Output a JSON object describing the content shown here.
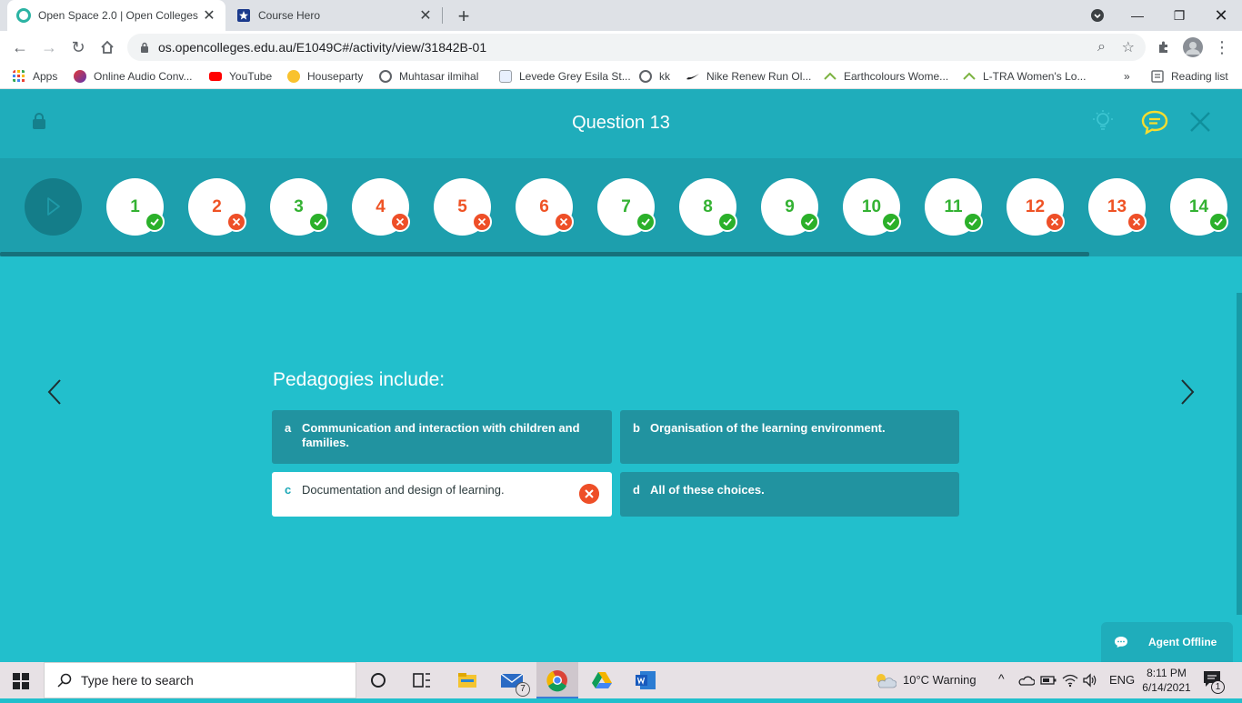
{
  "browser": {
    "tabs": [
      {
        "title": "Open Space 2.0 | Open Colleges",
        "active": true
      },
      {
        "title": "Course Hero",
        "active": false
      }
    ],
    "new_tab_label": "+",
    "url": "os.opencolleges.edu.au/E1049C#/activity/view/31842B-01",
    "bookmarks": [
      {
        "label": "Apps",
        "icon": "apps-grid-icon"
      },
      {
        "label": "Online Audio Conv...",
        "icon": "audio-converter-icon"
      },
      {
        "label": "YouTube",
        "icon": "youtube-icon"
      },
      {
        "label": "Houseparty",
        "icon": "houseparty-icon"
      },
      {
        "label": "Muhtasar ilmihal",
        "icon": "globe-icon"
      },
      {
        "label": "Levede Grey Esila St...",
        "icon": "store-icon"
      },
      {
        "label": "kk",
        "icon": "globe-icon"
      },
      {
        "label": "Nike Renew Run Ol...",
        "icon": "nike-icon"
      },
      {
        "label": "Earthcolours Wome...",
        "icon": "brand-icon"
      },
      {
        "label": "L-TRA Women's Lo...",
        "icon": "brand-icon"
      }
    ],
    "more_bookmarks": "»",
    "reading_list": "Reading list"
  },
  "app": {
    "title": "Question 13",
    "questions": [
      {
        "num": "1",
        "status": "correct"
      },
      {
        "num": "2",
        "status": "wrong"
      },
      {
        "num": "3",
        "status": "correct"
      },
      {
        "num": "4",
        "status": "wrong"
      },
      {
        "num": "5",
        "status": "wrong"
      },
      {
        "num": "6",
        "status": "wrong"
      },
      {
        "num": "7",
        "status": "correct"
      },
      {
        "num": "8",
        "status": "correct"
      },
      {
        "num": "9",
        "status": "correct"
      },
      {
        "num": "10",
        "status": "correct"
      },
      {
        "num": "11",
        "status": "correct"
      },
      {
        "num": "12",
        "status": "wrong"
      },
      {
        "num": "13",
        "status": "wrong"
      },
      {
        "num": "14",
        "status": "correct"
      }
    ],
    "prompt": "Pedagogies include:",
    "options": [
      {
        "letter": "a",
        "text": "Communication and interaction with children and families.",
        "selected": false
      },
      {
        "letter": "b",
        "text": "Organisation of the learning environment.",
        "selected": false
      },
      {
        "letter": "c",
        "text": "Documentation and design of learning.",
        "selected": true
      },
      {
        "letter": "d",
        "text": "All of these choices.",
        "selected": false
      }
    ],
    "agent_label": "Agent Offline"
  },
  "taskbar": {
    "search_placeholder": "Type here to search",
    "mail_count": "7",
    "weather": "10°C  Warning",
    "language": "ENG",
    "time": "8:11 PM",
    "date": "6/14/2021",
    "notifications": "1"
  },
  "colors": {
    "header": "#1fadbb",
    "strip": "#1d9fad",
    "content": "#22bfcc",
    "option": "#2193a0",
    "correct": "#34b233",
    "wrong": "#ef5325",
    "chat_icon": "#f7dd2f"
  }
}
